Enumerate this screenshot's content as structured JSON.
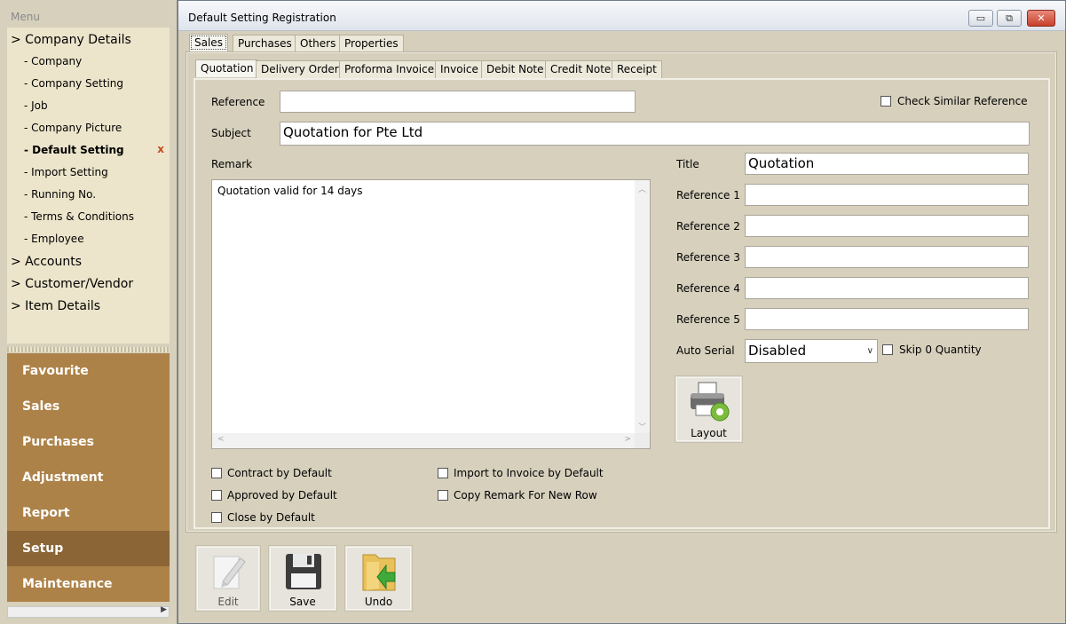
{
  "menu": {
    "header": "Menu",
    "tree": [
      {
        "label": "> Company Details",
        "level": "top"
      },
      {
        "label": "- Company",
        "level": "sub"
      },
      {
        "label": "- Company Setting",
        "level": "sub"
      },
      {
        "label": "- Job",
        "level": "sub"
      },
      {
        "label": "- Company Picture",
        "level": "sub"
      },
      {
        "label": "- Default Setting",
        "level": "sub",
        "active": true
      },
      {
        "label": "- Import Setting",
        "level": "sub"
      },
      {
        "label": "- Running No.",
        "level": "sub"
      },
      {
        "label": "- Terms & Conditions",
        "level": "sub"
      },
      {
        "label": "- Employee",
        "level": "sub"
      },
      {
        "label": "> Accounts",
        "level": "top"
      },
      {
        "label": "> Customer/Vendor",
        "level": "top"
      },
      {
        "label": "> Item Details",
        "level": "top"
      }
    ],
    "close_mark": "x",
    "nav": [
      {
        "label": "Favourite"
      },
      {
        "label": "Sales"
      },
      {
        "label": "Purchases"
      },
      {
        "label": "Adjustment"
      },
      {
        "label": "Report"
      },
      {
        "label": "Setup",
        "active": true
      },
      {
        "label": "Maintenance"
      }
    ]
  },
  "window": {
    "title": "Default Setting Registration",
    "controls": {
      "minimize": "▭",
      "maximize": "⧉",
      "close": "✕"
    }
  },
  "outer_tabs": [
    "Sales",
    "Purchases",
    "Others",
    "Properties"
  ],
  "outer_selected": "Sales",
  "inner_tabs": [
    "Quotation",
    "Delivery Order",
    "Proforma Invoice",
    "Invoice",
    "Debit Note",
    "Credit Note",
    "Receipt"
  ],
  "inner_selected": "Quotation",
  "form": {
    "reference_label": "Reference",
    "reference_value": "",
    "check_similar_label": "Check Similar Reference",
    "subject_label": "Subject",
    "subject_value": "Quotation for  Pte Ltd",
    "remark_label": "Remark",
    "remark_value": "Quotation valid for 14 days",
    "title_label": "Title",
    "title_value": "Quotation",
    "reference1_label": "Reference 1",
    "reference1_value": "",
    "reference2_label": "Reference 2",
    "reference2_value": "",
    "reference3_label": "Reference 3",
    "reference3_value": "",
    "reference4_label": "Reference 4",
    "reference4_value": "",
    "reference5_label": "Reference 5",
    "reference5_value": "",
    "auto_serial_label": "Auto Serial",
    "auto_serial_value": "Disabled",
    "skip_zero_label": "Skip 0 Quantity",
    "layout_label": "Layout",
    "contract_label": "Contract by Default",
    "approved_label": "Approved by Default",
    "close_label": "Close by Default",
    "import_invoice_label": "Import to Invoice by Default",
    "copy_remark_label": "Copy Remark For New Row"
  },
  "toolbar": {
    "edit_label": "Edit",
    "save_label": "Save",
    "undo_label": "Undo"
  },
  "colors": {
    "menu_nav": "#ad8248",
    "menu_nav_active": "#8b6536",
    "panel": "#d6d0bd"
  }
}
